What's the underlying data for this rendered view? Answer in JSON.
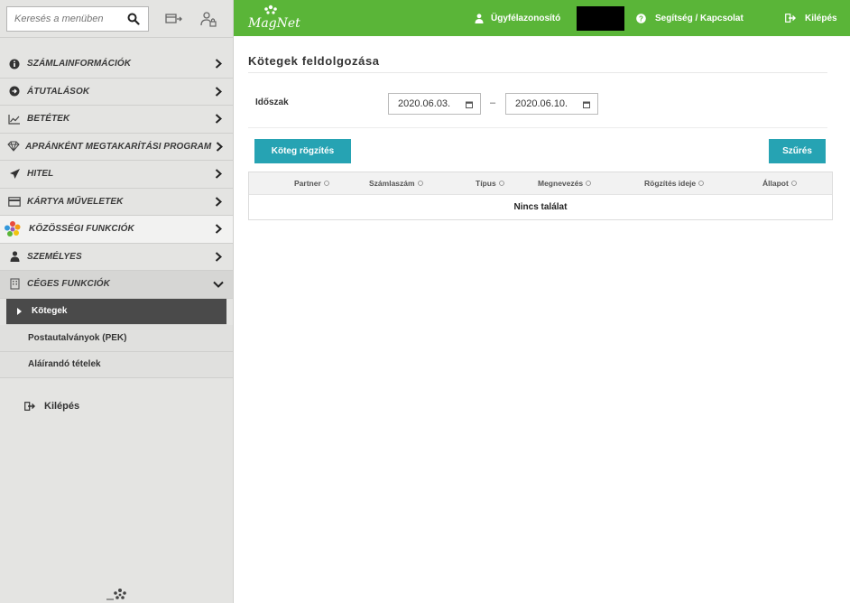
{
  "search": {
    "placeholder": "Keresés a menüben"
  },
  "top_icons": [
    "card-transfer-icon",
    "user-lock-icon"
  ],
  "sidebar": {
    "items": [
      {
        "label": "SZÁMLAINFORMÁCIÓK",
        "icon": "info-icon"
      },
      {
        "label": "ÁTUTALÁSOK",
        "icon": "transfer-icon"
      },
      {
        "label": "BETÉTEK",
        "icon": "chart-line-icon"
      },
      {
        "label": "APRÁNKÉNT MEGTAKARÍTÁSI PROGRAM",
        "icon": "diamond-icon"
      },
      {
        "label": "HITEL",
        "icon": "plane-icon"
      },
      {
        "label": "KÁRTYA MŰVELETEK",
        "icon": "credit-card-icon"
      },
      {
        "label": "KÖZÖSSÉGI FUNKCIÓK",
        "icon": "community-flower-icon"
      },
      {
        "label": "SZEMÉLYES",
        "icon": "person-icon"
      },
      {
        "label": "CÉGES FUNKCIÓK",
        "icon": "building-icon"
      }
    ],
    "subitems": [
      {
        "label": "Kötegek"
      },
      {
        "label": "Postautalványok (PEK)"
      },
      {
        "label": "Aláírandó tételek"
      }
    ],
    "logout_label": "Kilépés"
  },
  "header": {
    "brand": "MagNet",
    "user_label": "Ügyfélazonosító",
    "help_label": "Segítség / Kapcsolat",
    "logout_label": "Kilépés",
    "colors": {
      "header_green": "#5ab538",
      "accent_teal": "#26a3b3"
    }
  },
  "main": {
    "title": "Kötegek feldolgozása",
    "period_label": "Időszak",
    "date_from": "2020.06.03.",
    "date_separator": "–",
    "date_to": "2020.06.10.",
    "add_button": "Köteg rögzítés",
    "filter_button": "Szűrés",
    "table": {
      "columns": [
        "Partner",
        "Számlaszám",
        "Típus",
        "Megnevezés",
        "Rögzítés ideje",
        "Állapot"
      ],
      "empty_text": "Nincs találat"
    }
  }
}
